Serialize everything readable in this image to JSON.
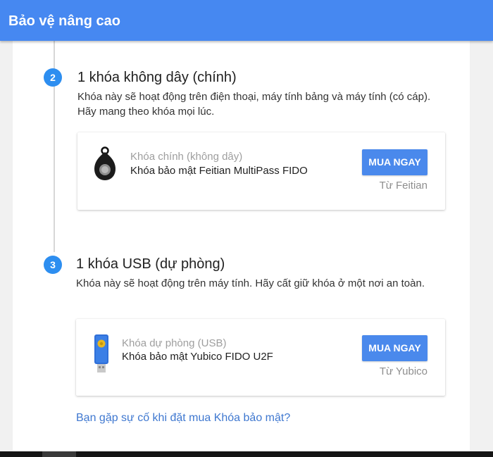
{
  "header": {
    "title": "Bảo vệ nâng cao"
  },
  "steps": [
    {
      "number": "2",
      "title": "1 khóa không dây (chính)",
      "description": "Khóa này sẽ hoạt động trên điện thoại, máy tính bảng và máy tính (có cáp). Hãy mang theo khóa mọi lúc.",
      "card": {
        "kind": "Khóa chính (không dây)",
        "product": "Khóa bảo mật Feitian MultiPass FIDO",
        "button": "MUA NGAY",
        "vendor": "Từ Feitian",
        "icon": "wireless-key-fob-icon"
      }
    },
    {
      "number": "3",
      "title": "1 khóa USB (dự phòng)",
      "description": "Khóa này sẽ hoạt động trên máy tính. Hãy cất giữ khóa ở một nơi an toàn.",
      "card": {
        "kind": "Khóa dự phòng (USB)",
        "product": "Khóa bảo mật Yubico FIDO U2F",
        "button": "MUA NGAY",
        "vendor": "Từ Yubico",
        "icon": "usb-key-icon"
      }
    }
  ],
  "help_link": "Bạn gặp sự cố khi đặt mua Khóa bảo mật?",
  "colors": {
    "header": "#4688f1",
    "step_badge": "#2d8ef0",
    "button": "#4a89ec",
    "link": "#3f78d0"
  }
}
